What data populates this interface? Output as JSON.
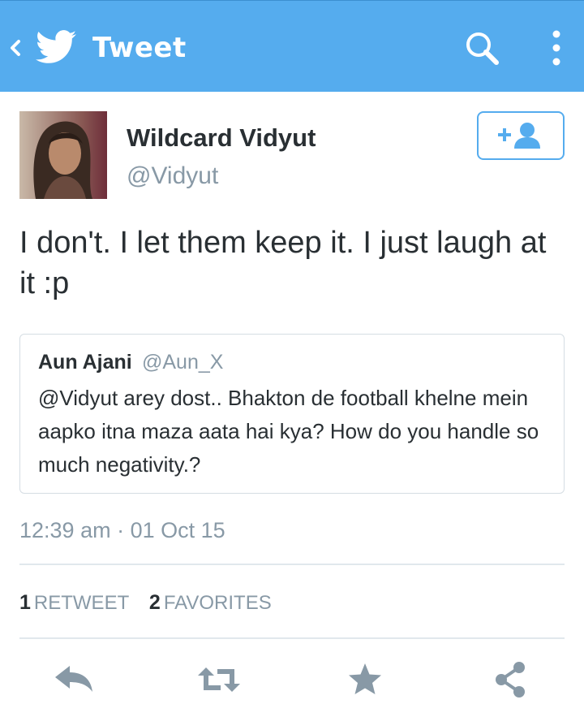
{
  "topbar": {
    "title": "Tweet",
    "color": "#55acee"
  },
  "icons": {
    "back": "chevron-left-icon",
    "logo": "twitter-bird-icon",
    "search": "search-icon",
    "more": "vertical-ellipsis-icon",
    "follow": "add-user-icon",
    "reply": "reply-icon",
    "retweet": "retweet-icon",
    "favorite": "star-icon",
    "share": "share-icon"
  },
  "tweet": {
    "author_name": "Wildcard Vidyut",
    "author_handle": "@Vidyut",
    "text": "I don't. I let them keep it. I just laugh at it :p",
    "timestamp": "12:39 am · 01 Oct 15"
  },
  "quoted_tweet": {
    "author_name": "Aun Ajani",
    "author_handle": "@Aun_X",
    "text": "@Vidyut arey dost.. Bhakton de football khelne mein aapko itna maza aata hai kya? How do you handle so much negativity.?"
  },
  "stats": {
    "retweets_count": "1",
    "retweets_label": "RETWEET",
    "favorites_count": "2",
    "favorites_label": "FAVORITES"
  }
}
